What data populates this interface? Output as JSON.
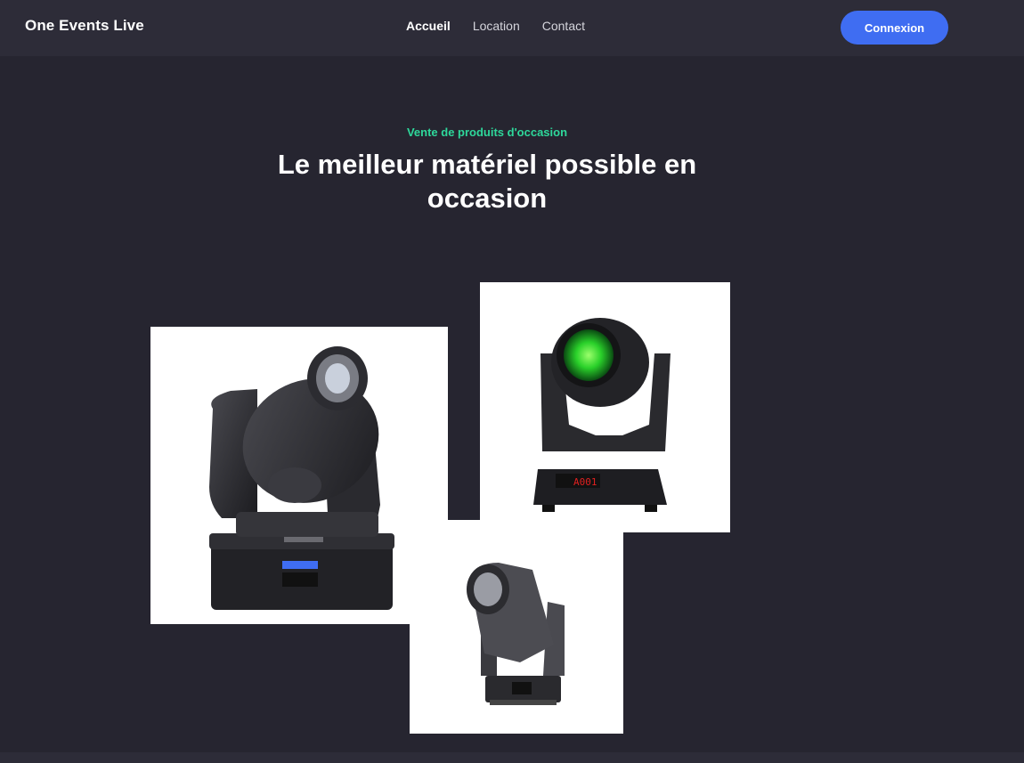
{
  "header": {
    "brand": "One Events Live",
    "nav": [
      {
        "label": "Accueil",
        "active": true
      },
      {
        "label": "Location",
        "active": false
      },
      {
        "label": "Contact",
        "active": false
      }
    ],
    "login_label": "Connexion"
  },
  "hero": {
    "eyebrow": "Vente de produits d'occasion",
    "title": "Le meilleur matériel possible en occasion"
  },
  "products": {
    "images": [
      {
        "icon": "moving-head-light-image"
      },
      {
        "icon": "moving-head-beam-light-image",
        "display_text": "A001"
      },
      {
        "icon": "moving-head-spot-light-image"
      }
    ]
  },
  "colors": {
    "background": "#262530",
    "header": "#2d2c38",
    "accent": "#3f6df2",
    "eyebrow": "#2ed89b"
  }
}
